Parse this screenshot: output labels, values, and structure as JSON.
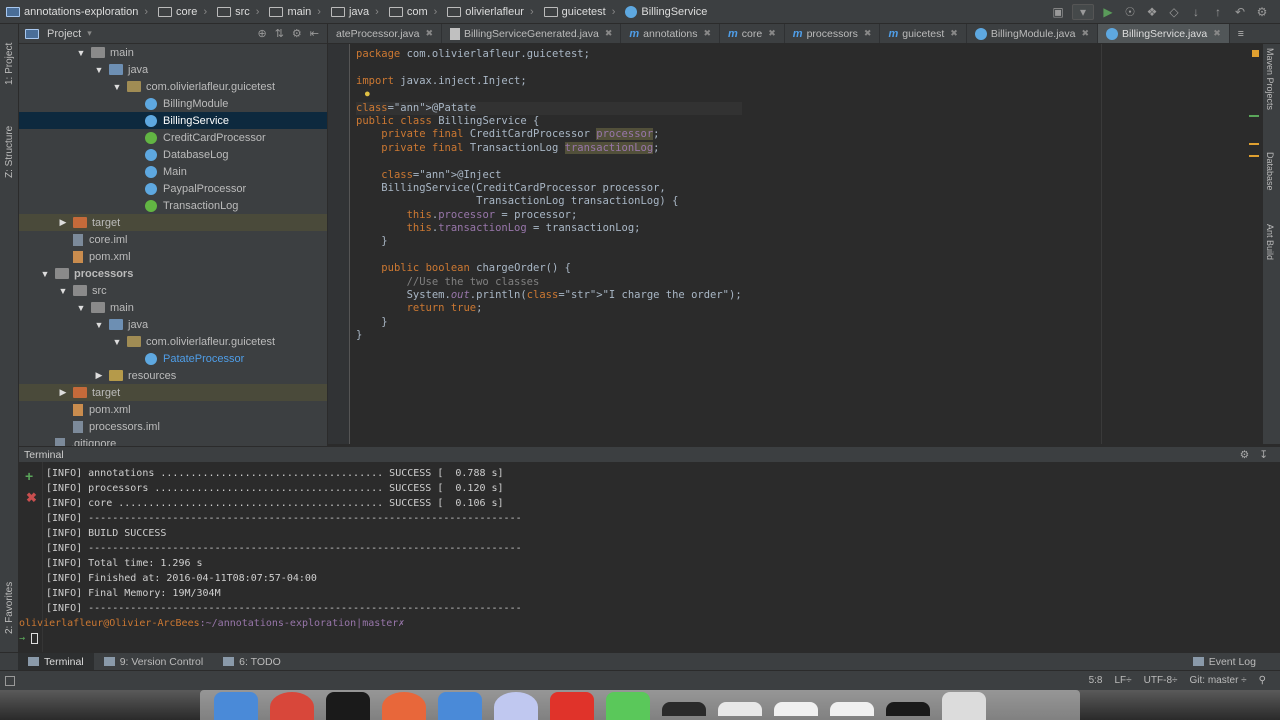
{
  "breadcrumbs": [
    "annotations-exploration",
    "core",
    "src",
    "main",
    "java",
    "com",
    "olivierlafleur",
    "guicetest",
    "BillingService"
  ],
  "project_panel": {
    "title": "Project",
    "tree": [
      {
        "label": "main",
        "kind": "folder",
        "indent": 3,
        "arrow": "open"
      },
      {
        "label": "java",
        "kind": "src",
        "indent": 4,
        "arrow": "open"
      },
      {
        "label": "com.olivierlafleur.guicetest",
        "kind": "pkg",
        "indent": 5,
        "arrow": "open"
      },
      {
        "label": "BillingModule",
        "kind": "class",
        "indent": 6
      },
      {
        "label": "BillingService",
        "kind": "class",
        "indent": 6,
        "selected": true
      },
      {
        "label": "CreditCardProcessor",
        "kind": "iface",
        "indent": 6
      },
      {
        "label": "DatabaseLog",
        "kind": "class",
        "indent": 6
      },
      {
        "label": "Main",
        "kind": "class",
        "indent": 6
      },
      {
        "label": "PaypalProcessor",
        "kind": "class",
        "indent": 6
      },
      {
        "label": "TransactionLog",
        "kind": "iface",
        "indent": 6
      },
      {
        "label": "target",
        "kind": "target",
        "indent": 2,
        "arrow": "closed",
        "excluded": true
      },
      {
        "label": "core.iml",
        "kind": "iml",
        "indent": 2
      },
      {
        "label": "pom.xml",
        "kind": "xml",
        "indent": 2
      },
      {
        "label": "processors",
        "kind": "folder",
        "indent": 1,
        "arrow": "open",
        "bold": true
      },
      {
        "label": "src",
        "kind": "folder",
        "indent": 2,
        "arrow": "open"
      },
      {
        "label": "main",
        "kind": "folder",
        "indent": 3,
        "arrow": "open"
      },
      {
        "label": "java",
        "kind": "src",
        "indent": 4,
        "arrow": "open"
      },
      {
        "label": "com.olivierlafleur.guicetest",
        "kind": "pkg",
        "indent": 5,
        "arrow": "open"
      },
      {
        "label": "PatateProcessor",
        "kind": "class",
        "indent": 6,
        "link": true
      },
      {
        "label": "resources",
        "kind": "res",
        "indent": 4,
        "arrow": "closed"
      },
      {
        "label": "target",
        "kind": "target",
        "indent": 2,
        "arrow": "closed",
        "excluded": true
      },
      {
        "label": "pom.xml",
        "kind": "xml",
        "indent": 2
      },
      {
        "label": "processors.iml",
        "kind": "iml",
        "indent": 2
      },
      {
        "label": ".gitignore",
        "kind": "iml",
        "indent": 1
      }
    ]
  },
  "editor_tabs": [
    {
      "label": "ateProcessor.java",
      "icon": "java"
    },
    {
      "label": "BillingServiceGenerated.java",
      "icon": "java"
    },
    {
      "label": "annotations",
      "icon": "m"
    },
    {
      "label": "core",
      "icon": "m"
    },
    {
      "label": "processors",
      "icon": "m"
    },
    {
      "label": "guicetest",
      "icon": "m"
    },
    {
      "label": "BillingModule.java",
      "icon": "class"
    },
    {
      "label": "BillingService.java",
      "icon": "class",
      "active": true
    }
  ],
  "code_lines": [
    "package com.olivierlafleur.guicetest;",
    "",
    "import javax.inject.Inject;",
    "",
    "@Patate",
    "public class BillingService {",
    "    private final CreditCardProcessor processor;",
    "    private final TransactionLog transactionLog;",
    "",
    "    @Inject",
    "    BillingService(CreditCardProcessor processor,",
    "                   TransactionLog transactionLog) {",
    "        this.processor = processor;",
    "        this.transactionLog = transactionLog;",
    "    }",
    "",
    "    public boolean chargeOrder() {",
    "        //Use the two classes",
    "        System.out.println(\"I charge the order\");",
    "        return true;",
    "    }",
    "}"
  ],
  "terminal": {
    "title": "Terminal",
    "lines": [
      "[INFO] annotations ..................................... SUCCESS [  0.788 s]",
      "[INFO] processors ...................................... SUCCESS [  0.120 s]",
      "[INFO] core ............................................ SUCCESS [  0.106 s]",
      "[INFO] ------------------------------------------------------------------------",
      "[INFO] BUILD SUCCESS",
      "[INFO] ------------------------------------------------------------------------",
      "[INFO] Total time: 1.296 s",
      "[INFO] Finished at: 2016-04-11T08:07:57-04:00",
      "[INFO] Final Memory: 19M/304M",
      "[INFO] ------------------------------------------------------------------------"
    ],
    "prompt_user": "olivierlafleur@Olivier-ArcBees",
    "prompt_path": ":~/annotations-exploration",
    "prompt_branch": "|master✗",
    "prompt_arrow": "→"
  },
  "bottom_tabs": [
    {
      "label": "Terminal",
      "active": true
    },
    {
      "label": "9: Version Control"
    },
    {
      "label": "6: TODO"
    }
  ],
  "event_log": "Event Log",
  "status": {
    "position": "5:8",
    "line_sep": "LF÷",
    "encoding": "UTF-8÷",
    "vcs": "Git: master ÷"
  },
  "left_tabs": [
    "1: Project",
    "Z: Structure",
    "2: Favorites"
  ],
  "right_tabs": [
    "Maven Projects",
    "Database",
    "Ant Build"
  ]
}
